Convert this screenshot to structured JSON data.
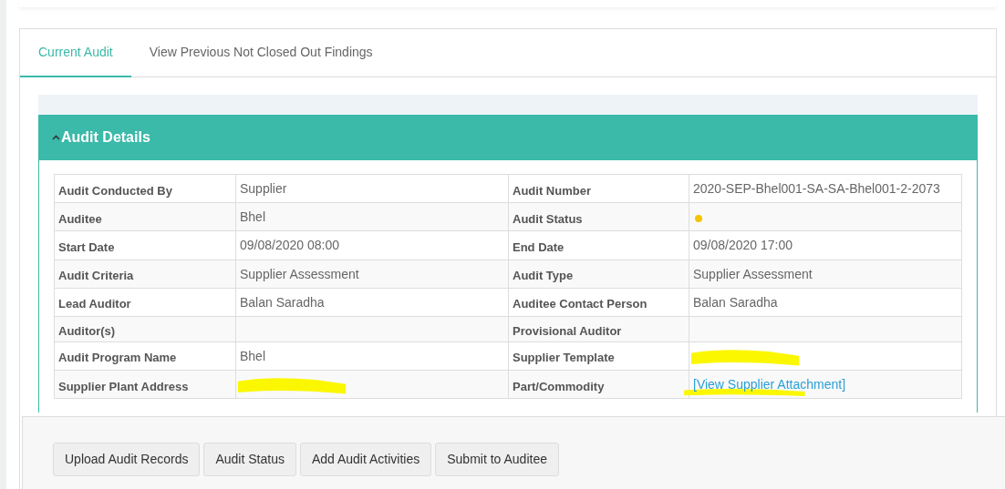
{
  "tabs": [
    {
      "label": "Current Audit",
      "selected": true
    },
    {
      "label": "View Previous Not Closed Out Findings",
      "selected": false
    }
  ],
  "section": {
    "title": "Audit Details",
    "expanded": true
  },
  "details": [
    {
      "label": "Audit Conducted By",
      "value": "Supplier"
    },
    {
      "label": "Audit Number",
      "value": "2020-SEP-Bhel001-SA-SA-Bhel001-2-2073"
    },
    {
      "label": "Auditee",
      "value": "Bhel"
    },
    {
      "label": "Audit Status",
      "kind": "status",
      "color": "#f5c400"
    },
    {
      "label": "Start Date",
      "value": "09/08/2020 08:00"
    },
    {
      "label": "End Date",
      "value": "09/08/2020 17:00"
    },
    {
      "label": "Audit Criteria",
      "value": "Supplier Assessment"
    },
    {
      "label": "Audit Type",
      "value": "Supplier Assessment"
    },
    {
      "label": "Lead Auditor",
      "value": "Balan Saradha"
    },
    {
      "label": "Auditee Contact Person",
      "value": "Balan Saradha"
    },
    {
      "label": "Auditor(s)"
    },
    {
      "label": "Provisional Auditor"
    },
    {
      "label": "Audit Program Name",
      "value": "Bhel"
    },
    {
      "label": "Supplier Template",
      "redacted": true
    },
    {
      "label": "Supplier Plant Address",
      "redacted": true
    },
    {
      "label": "Part/Commodity",
      "kind": "link",
      "value": "[View Supplier Attachment]",
      "redacted": true
    }
  ],
  "buttons": [
    "Upload Audit Records",
    "Audit Status",
    "Add Audit Activities",
    "Submit to Auditee"
  ]
}
